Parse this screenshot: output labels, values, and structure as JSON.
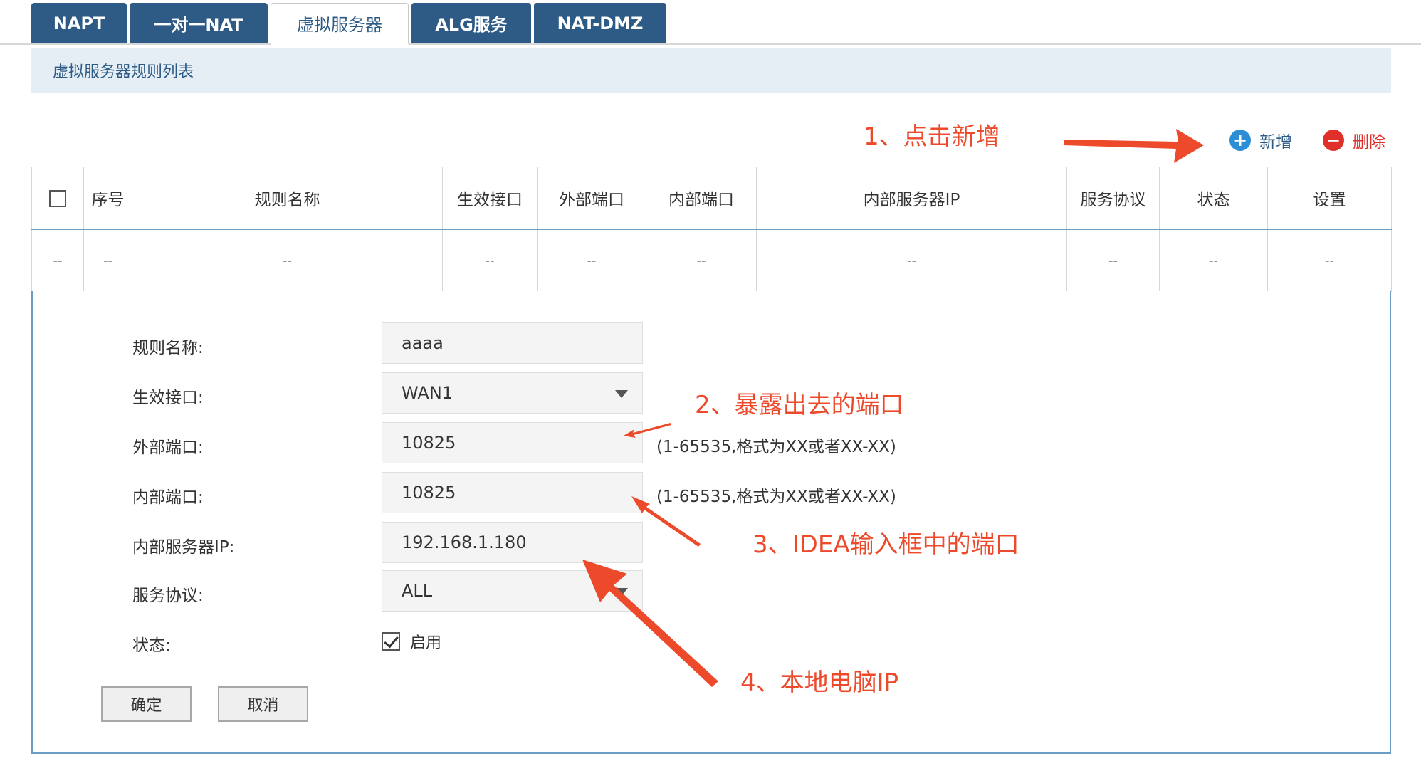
{
  "tabs": [
    {
      "label": "NAPT",
      "active": false
    },
    {
      "label": "一对一NAT",
      "active": false
    },
    {
      "label": "虚拟服务器",
      "active": true
    },
    {
      "label": "ALG服务",
      "active": false
    },
    {
      "label": "NAT-DMZ",
      "active": false
    }
  ],
  "section": {
    "title": "虚拟服务器规则列表"
  },
  "toolbar": {
    "add_label": "新增",
    "add_icon": "plus-circle-icon",
    "delete_label": "删除",
    "delete_icon": "minus-circle-icon"
  },
  "table": {
    "columns": [
      "序号",
      "规则名称",
      "生效接口",
      "外部端口",
      "内部端口",
      "内部服务器IP",
      "服务协议",
      "状态",
      "设置"
    ],
    "rows": [
      [
        "--",
        "--",
        "--",
        "--",
        "--",
        "--",
        "--",
        "--",
        "--",
        "--"
      ]
    ]
  },
  "form": {
    "rule_name_label": "规则名称:",
    "rule_name_value": "aaaa",
    "interface_label": "生效接口:",
    "interface_value": "WAN1",
    "ext_port_label": "外部端口:",
    "ext_port_value": "10825",
    "ext_port_hint": "(1-65535,格式为XX或者XX-XX)",
    "int_port_label": "内部端口:",
    "int_port_value": "10825",
    "int_port_hint": "(1-65535,格式为XX或者XX-XX)",
    "server_ip_label": "内部服务器IP:",
    "server_ip_value": "192.168.1.180",
    "protocol_label": "服务协议:",
    "protocol_value": "ALL",
    "status_label": "状态:",
    "status_checkbox_label": "启用",
    "status_checked": true,
    "ok_label": "确定",
    "cancel_label": "取消"
  },
  "annotations": {
    "note1": "1、点击新增",
    "note2": "2、暴露出去的端口",
    "note3": "3、IDEA输入框中的端口",
    "note4": "4、本地电脑IP",
    "color": "#ec4a2b"
  },
  "colors": {
    "tab_bg": "#2d5b86",
    "header_bg": "#e5eef5",
    "add_icon": "#2b8ed6",
    "delete_icon": "#e0302a"
  }
}
